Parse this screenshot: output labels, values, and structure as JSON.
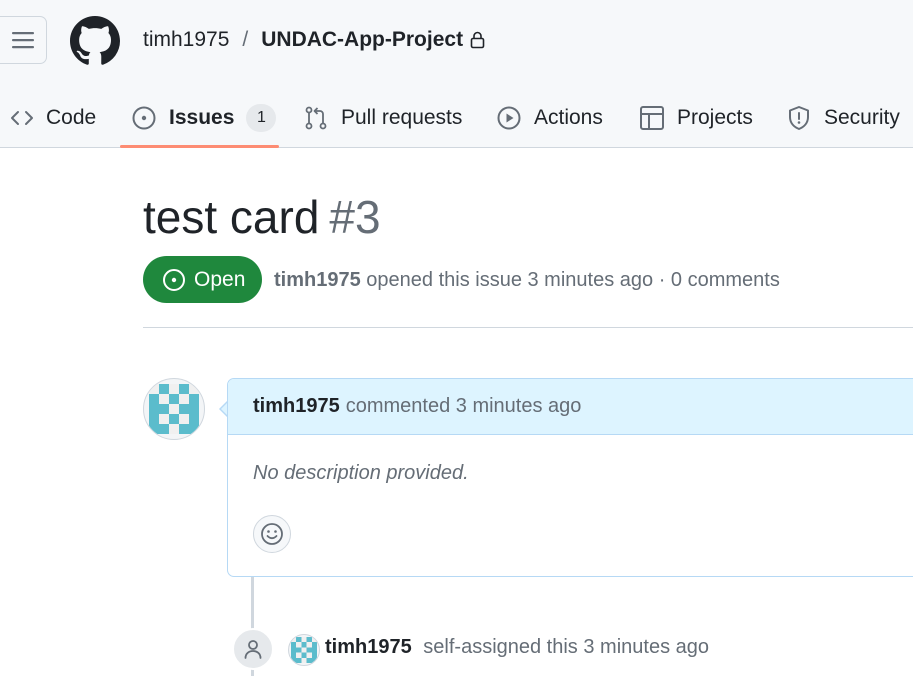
{
  "header": {
    "owner": "timh1975",
    "separator": "/",
    "repo": "UNDAC-App-Project"
  },
  "tabs": [
    {
      "label": "Code",
      "icon": "code-icon"
    },
    {
      "label": "Issues",
      "icon": "issue-opened-icon",
      "counter": "1",
      "selected": true
    },
    {
      "label": "Pull requests",
      "icon": "git-pull-request-icon"
    },
    {
      "label": "Actions",
      "icon": "play-icon"
    },
    {
      "label": "Projects",
      "icon": "table-icon"
    },
    {
      "label": "Security",
      "icon": "shield-icon"
    }
  ],
  "issue": {
    "title": "test card",
    "number": "#3",
    "state": "Open",
    "author": "timh1975",
    "meta_text": "opened this issue 3 minutes ago · 0 comments"
  },
  "comment": {
    "author": "timh1975",
    "action": "commented 3 minutes ago",
    "body": "No description provided."
  },
  "event": {
    "author": "timh1975",
    "text": "self-assigned this 3 minutes ago"
  },
  "colors": {
    "open_green": "#1f883d",
    "tab_underline": "#fd8c73",
    "comment_header_bg": "#ddf4ff",
    "avatar_teal": "#5bbccc"
  }
}
